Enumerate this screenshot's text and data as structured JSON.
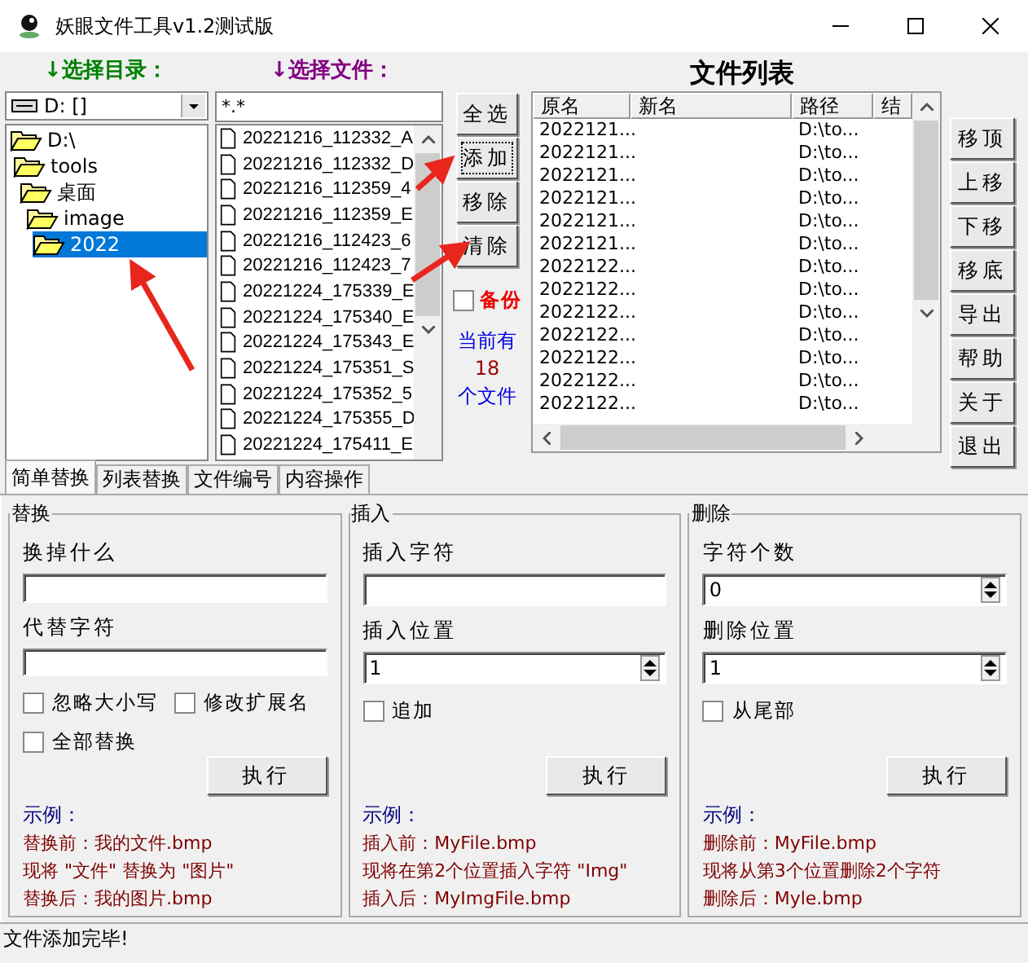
{
  "window": {
    "title": "妖眼文件工具v1.2测试版"
  },
  "directory": {
    "label": "↓选择目录：",
    "drive": "D: []",
    "tree": [
      {
        "label": "D:\\",
        "selected": false,
        "children": [
          {
            "label": "tools",
            "selected": false,
            "children": [
              {
                "label": "桌面",
                "selected": false,
                "children": [
                  {
                    "label": "image",
                    "selected": false,
                    "children": [
                      {
                        "label": "2022",
                        "selected": true
                      }
                    ]
                  }
                ]
              }
            ]
          }
        ]
      }
    ]
  },
  "files": {
    "label": "↓选择文件：",
    "filter": "*.*",
    "items": [
      "20221216_112332_A",
      "20221216_112332_D",
      "20221216_112359_4",
      "20221216_112359_E",
      "20221216_112423_6",
      "20221216_112423_7",
      "20221224_175339_E",
      "20221224_175340_E",
      "20221224_175343_E",
      "20221224_175351_S",
      "20221224_175352_5",
      "20221224_175355_D",
      "20221224_175411_E"
    ]
  },
  "file_buttons": [
    {
      "label": "全选",
      "focused": false
    },
    {
      "label": "添加",
      "focused": true
    },
    {
      "label": "移除",
      "focused": false
    },
    {
      "label": "清除",
      "focused": false
    }
  ],
  "backup": {
    "label": "备份",
    "checked": false
  },
  "count": {
    "prefix": "当前有",
    "value": "18",
    "suffix": "个文件"
  },
  "file_list": {
    "title": "文件列表",
    "columns": [
      "原名",
      "新名",
      "路径",
      "结"
    ],
    "rows": [
      {
        "original": "2022121...",
        "path": "D:\\to..."
      },
      {
        "original": "2022121...",
        "path": "D:\\to..."
      },
      {
        "original": "2022121...",
        "path": "D:\\to..."
      },
      {
        "original": "2022121...",
        "path": "D:\\to..."
      },
      {
        "original": "2022121...",
        "path": "D:\\to..."
      },
      {
        "original": "2022121...",
        "path": "D:\\to..."
      },
      {
        "original": "2022122...",
        "path": "D:\\to..."
      },
      {
        "original": "2022122...",
        "path": "D:\\to..."
      },
      {
        "original": "2022122...",
        "path": "D:\\to..."
      },
      {
        "original": "2022122...",
        "path": "D:\\to..."
      },
      {
        "original": "2022122...",
        "path": "D:\\to..."
      },
      {
        "original": "2022122...",
        "path": "D:\\to..."
      },
      {
        "original": "2022122...",
        "path": "D:\\to..."
      }
    ]
  },
  "list_buttons": [
    "移顶",
    "上移",
    "下移",
    "移底",
    "导出",
    "帮助",
    "关于",
    "退出"
  ],
  "tabs": [
    {
      "label": "简单替换",
      "selected": true
    },
    {
      "label": "列表替换",
      "selected": false
    },
    {
      "label": "文件编号",
      "selected": false
    },
    {
      "label": "内容操作",
      "selected": false
    }
  ],
  "groups": [
    {
      "title": "替换",
      "fields": [
        {
          "kind": "text",
          "label": "换掉什么"
        },
        {
          "kind": "text",
          "label": "代替字符"
        }
      ],
      "checkboxes": [
        {
          "label": "忽略大小写",
          "checked": false
        },
        {
          "label": "修改扩展名",
          "checked": false
        },
        {
          "label": "全部替换",
          "checked": false
        }
      ],
      "button": "执行",
      "example_label": "示例：",
      "examples": [
        "替换前：我的文件.bmp",
        "现将 \"文件\" 替换为 \"图片\"",
        "替换后：我的图片.bmp"
      ]
    },
    {
      "title": "插入",
      "fields": [
        {
          "kind": "text",
          "label": "插入字符"
        },
        {
          "kind": "spin",
          "label": "插入位置",
          "value": "1"
        }
      ],
      "checkboxes": [
        {
          "label": "追加",
          "checked": false
        }
      ],
      "button": "执行",
      "example_label": "示例：",
      "examples": [
        "插入前：MyFile.bmp",
        "现将在第2个位置插入字符 \"Img\"",
        "插入后：MyImgFile.bmp"
      ]
    },
    {
      "title": "删除",
      "fields": [
        {
          "kind": "spin",
          "label": "字符个数",
          "value": "0"
        },
        {
          "kind": "spin",
          "label": "删除位置",
          "value": "1"
        }
      ],
      "checkboxes": [
        {
          "label": "从尾部",
          "checked": false
        }
      ],
      "button": "执行",
      "example_label": "示例：",
      "examples": [
        "删除前：MyFile.bmp",
        "现将从第3个位置删除2个字符",
        "删除后：Myle.bmp"
      ]
    }
  ],
  "status_bar": "文件添加完毕!"
}
